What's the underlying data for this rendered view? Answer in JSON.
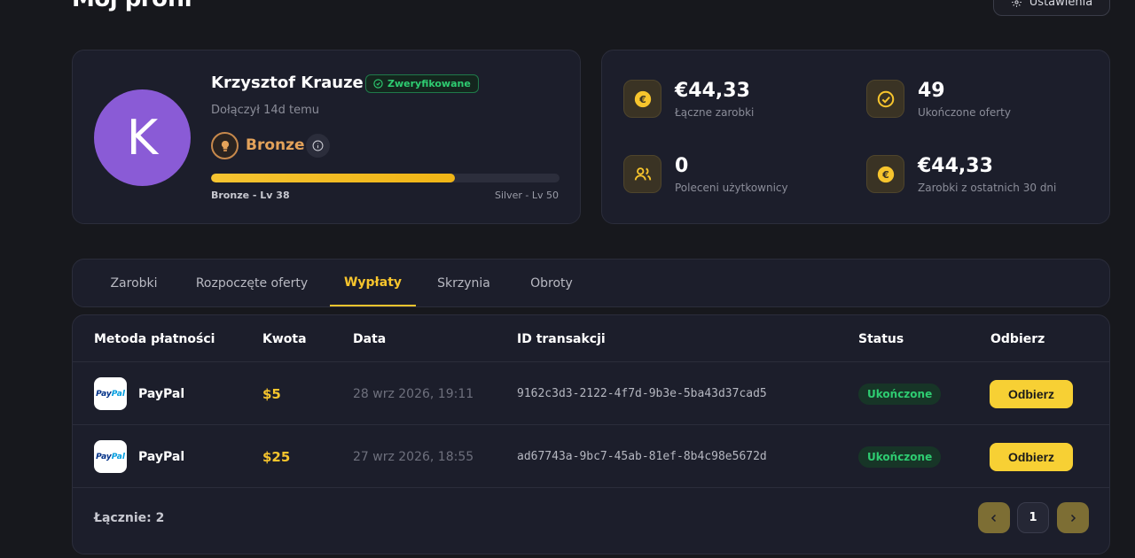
{
  "header": {
    "title": "Mój profil",
    "settings_label": "Ustawienia"
  },
  "profile": {
    "avatar_letter": "K",
    "name": "Krzysztof Krauze",
    "verified_label": "Zweryfikowane",
    "joined": "Dołączył 14d temu",
    "rank": "Bronze",
    "progress_fraction": 0.7,
    "level_current": "Bronze - Lv 38",
    "level_next": "Silver - Lv 50"
  },
  "stats": [
    {
      "value": "€44,33",
      "label": "Łączne zarobki",
      "icon": "euro-icon"
    },
    {
      "value": "49",
      "label": "Ukończone oferty",
      "icon": "check-circle-icon"
    },
    {
      "value": "0",
      "label": "Poleceni użytkownicy",
      "icon": "users-icon"
    },
    {
      "value": "€44,33",
      "label": "Zarobki z ostatnich 30 dni",
      "icon": "euro-icon"
    }
  ],
  "tabs": [
    {
      "label": "Zarobki",
      "active": false
    },
    {
      "label": "Rozpoczęte oferty",
      "active": false
    },
    {
      "label": "Wypłaty",
      "active": true
    },
    {
      "label": "Skrzynia",
      "active": false
    },
    {
      "label": "Obroty",
      "active": false
    }
  ],
  "table": {
    "headers": {
      "method": "Metoda płatności",
      "amount": "Kwota",
      "date": "Data",
      "txid": "ID transakcji",
      "status": "Status",
      "claim": "Odbierz"
    },
    "rows": [
      {
        "logo_text_a": "Pay",
        "logo_text_b": "Pal",
        "method": "PayPal",
        "amount": "$5",
        "date": "28 wrz 2026, 19:11",
        "txid": "9162c3d3-2122-4f7d-9b3e-5ba43d37cad5",
        "status": "Ukończone",
        "claim": "Odbierz"
      },
      {
        "logo_text_a": "Pay",
        "logo_text_b": "Pal",
        "method": "PayPal",
        "amount": "$25",
        "date": "27 wrz 2026, 18:55",
        "txid": "ad67743a-9bc7-45ab-81ef-8b4c98e5672d",
        "status": "Ukończone",
        "claim": "Odbierz"
      }
    ],
    "total": "Łącznie: 2",
    "page": "1"
  },
  "colors": {
    "accent": "#f7c52d",
    "success": "#2ecc71",
    "background": "#17181d",
    "card": "#1c1e2b"
  }
}
